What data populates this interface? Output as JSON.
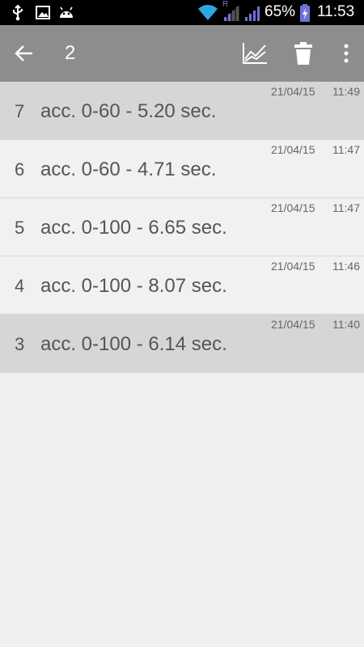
{
  "status_bar": {
    "battery": "65%",
    "time": "11:53",
    "roaming_indicator": "R",
    "icons": [
      "usb-icon",
      "image-icon",
      "android-icon",
      "wifi-icon",
      "signal-icon",
      "battery-charging-icon"
    ]
  },
  "action_bar": {
    "title": "2",
    "icons": [
      "back-arrow-icon",
      "chart-icon",
      "trash-icon",
      "overflow-menu-icon"
    ]
  },
  "records": [
    {
      "num": "7",
      "text": "acc. 0-60 - 5.20 sec.",
      "date": "21/04/15",
      "time": "11:49",
      "highlighted": true
    },
    {
      "num": "6",
      "text": "acc. 0-60 - 4.71 sec.",
      "date": "21/04/15",
      "time": "11:47",
      "highlighted": false
    },
    {
      "num": "5",
      "text": "acc. 0-100 - 6.65 sec.",
      "date": "21/04/15",
      "time": "11:47",
      "highlighted": false
    },
    {
      "num": "4",
      "text": "acc. 0-100 - 8.07 sec.",
      "date": "21/04/15",
      "time": "11:46",
      "highlighted": false
    },
    {
      "num": "3",
      "text": "acc. 0-100 - 6.14 sec.",
      "date": "21/04/15",
      "time": "11:40",
      "highlighted": true
    }
  ],
  "colors": {
    "action_bar": "#8d8d8d",
    "background": "#efeff1",
    "highlight_row": "#d6d6d6",
    "wifi": "#2aa7e0",
    "signal": "#6f72d8"
  }
}
